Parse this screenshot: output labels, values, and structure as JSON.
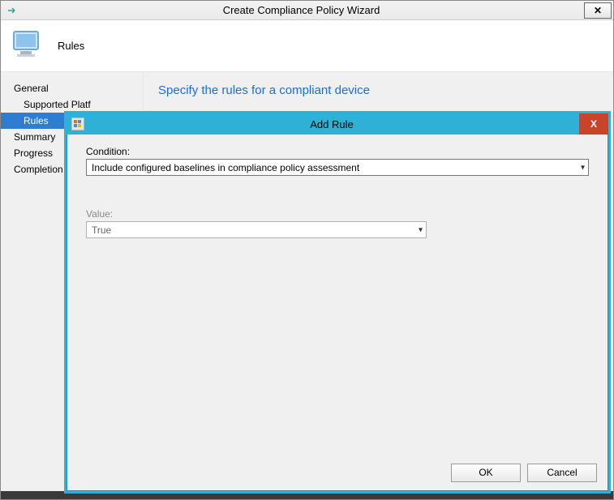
{
  "wizard": {
    "title": "Create Compliance Policy Wizard",
    "header_icon_name": "monitor-icon",
    "header_label": "Rules",
    "content_heading": "Specify the rules for a compliant device",
    "close_glyph": "✕"
  },
  "sidebar": {
    "items": [
      {
        "label": "General",
        "indent": false,
        "selected": false
      },
      {
        "label": "Supported Platf",
        "indent": true,
        "selected": false
      },
      {
        "label": "Rules",
        "indent": true,
        "selected": true
      },
      {
        "label": "Summary",
        "indent": false,
        "selected": false
      },
      {
        "label": "Progress",
        "indent": false,
        "selected": false
      },
      {
        "label": "Completion",
        "indent": false,
        "selected": false
      }
    ]
  },
  "modal": {
    "title": "Add Rule",
    "close_glyph": "X",
    "condition_label": "Condition:",
    "condition_value": "Include configured baselines in compliance policy assessment",
    "value_label": "Value:",
    "value_value": "True",
    "ok_label": "OK",
    "cancel_label": "Cancel"
  }
}
